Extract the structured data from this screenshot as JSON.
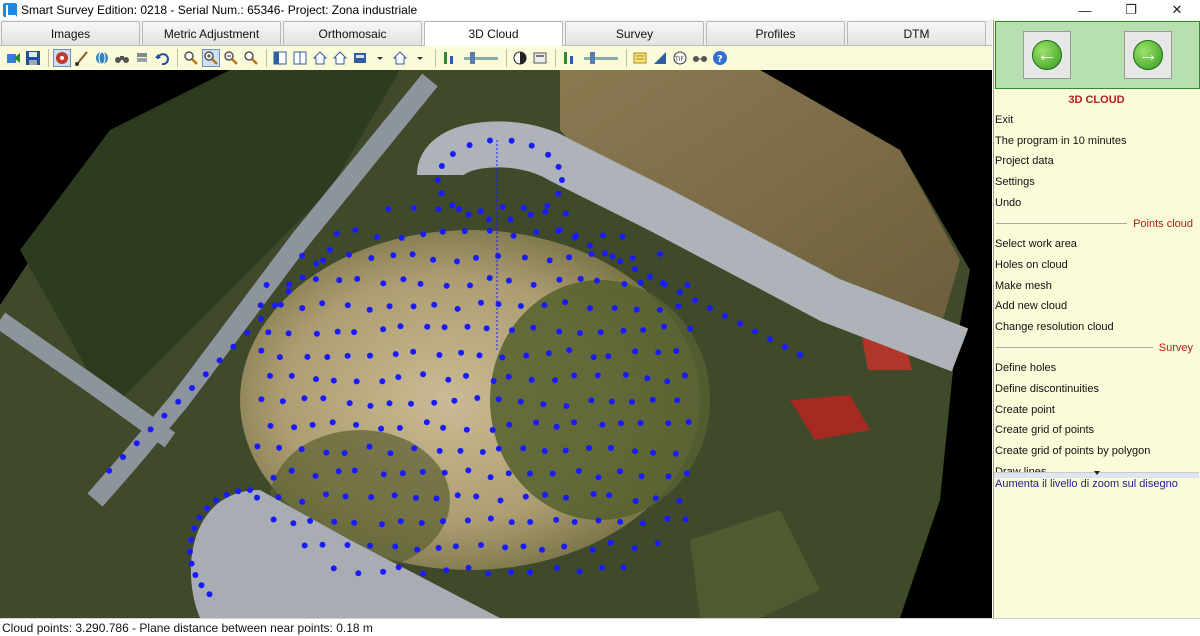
{
  "window": {
    "title": "Smart Survey  Edition: 0218 - Serial Num.: 65346- Project: Zona industriale",
    "minimize": "—",
    "restore": "❐",
    "close": "✕"
  },
  "tabs": [
    {
      "label": "Images"
    },
    {
      "label": "Metric Adjustment"
    },
    {
      "label": "Orthomosaic"
    },
    {
      "label": "3D Cloud"
    },
    {
      "label": "Survey"
    },
    {
      "label": "Profiles"
    },
    {
      "label": "DTM"
    }
  ],
  "active_tab": "3D Cloud",
  "panel": {
    "title": "3D CLOUD",
    "back_icon": "arrow-left-icon",
    "forward_icon": "arrow-right-icon",
    "general": [
      "Exit",
      "The program in 10 minutes",
      "Project data",
      "Settings",
      "Undo"
    ],
    "points_cloud": {
      "heading": "Points cloud",
      "items": [
        "Select work area",
        "Holes on cloud",
        "Make mesh",
        "Add new cloud",
        "Change resolution cloud"
      ]
    },
    "survey": {
      "heading": "Survey",
      "items": [
        "Define holes",
        "Define discontinuities",
        "Create point",
        "Create grid of points",
        "Create grid of points by polygon",
        "Draw lines"
      ]
    },
    "hint": "Aumenta il livello di zoom sul disegno"
  },
  "status": {
    "text": "Cloud points: 3.290.786 - Plane distance between near points: 0.18 m"
  },
  "colors": {
    "accent_red": "#b0211c",
    "panel_bg": "#fbfbd9",
    "nav_green": "#b7dfb0",
    "survey_point": "#1a1aff"
  }
}
